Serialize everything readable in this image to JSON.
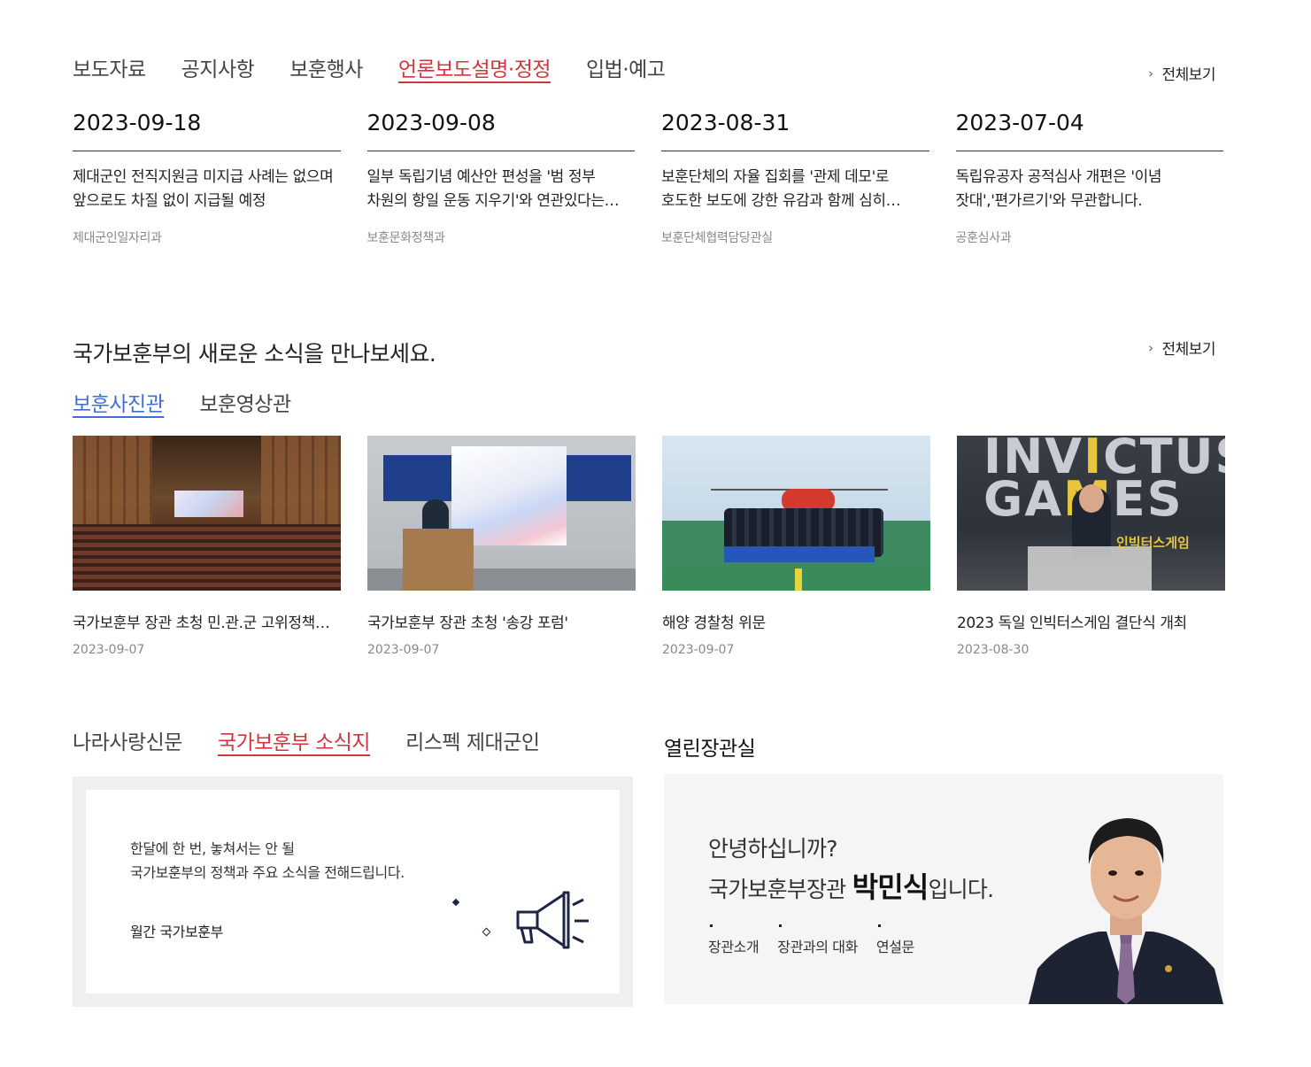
{
  "news": {
    "tabs": [
      "보도자료",
      "공지사항",
      "보훈행사",
      "언론보도설명·정정",
      "입법·예고"
    ],
    "active_tab": 3,
    "view_all": "전체보기",
    "items": [
      {
        "date": "2023-09-18",
        "title": "제대군인 전직지원금 미지급 사례는 없으며 앞으로도 차질 없이 지급될 예정",
        "dept": "제대군인일자리과"
      },
      {
        "date": "2023-09-08",
        "title": "일부 독립기념 예산안 편성을 '범 정부 차원의 항일 운동 지우기'와 연관있다는 보도는 사실과 다릅니다",
        "dept": "보훈문화정책과"
      },
      {
        "date": "2023-08-31",
        "title": "보훈단체의 자율 집회를 '관제 데모'로 호도한 보도에 강한 유감과 함께 심히 우려를 표합니다",
        "dept": "보훈단체협력담당관실"
      },
      {
        "date": "2023-07-04",
        "title": "독립유공자 공적심사 개편은 '이념 잣대','편가르기'와 무관합니다.",
        "dept": "공훈심사과"
      }
    ]
  },
  "gallery": {
    "heading": "국가보훈부의 새로운 소식을 만나보세요.",
    "view_all": "전체보기",
    "tabs": [
      "보훈사진관",
      "보훈영상관"
    ],
    "active_tab": 0,
    "items": [
      {
        "title": "국가보훈부 장관 초청 민.관.군 고위정책과정 특강",
        "date": "2023-09-07"
      },
      {
        "title": "국가보훈부 장관 초청 '송강 포럼'",
        "date": "2023-09-07"
      },
      {
        "title": "해양 경찰청 위문",
        "date": "2023-09-07"
      },
      {
        "title": "2023 독일 인빅터스게임 결단식 개최",
        "date": "2023-08-30"
      }
    ],
    "photo_texts": {
      "invictus_line1a": "INV",
      "invictus_line1b": "I",
      "invictus_line1c": "CTUS",
      "invictus_line2a": "GA",
      "invictus_line2b": "M",
      "invictus_line2c": "ES",
      "invictus_sub": "인빅터스게임"
    }
  },
  "newsletter": {
    "tabs": [
      "나라사랑신문",
      "국가보훈부 소식지",
      "리스펙 제대군인"
    ],
    "active_tab": 1,
    "desc_line1": "한달에 한 번, 놓쳐서는 안 될",
    "desc_line2": "국가보훈부의 정책과 주요 소식을 전해드립니다.",
    "label": "월간 국가보훈부",
    "icon": "megaphone-icon"
  },
  "minister": {
    "title": "열린장관실",
    "greeting": "안녕하십니까?",
    "intro_prefix": "국가보훈부장관 ",
    "name": "박민식",
    "intro_suffix": "입니다.",
    "links": [
      "장관소개",
      "장관과의 대화",
      "연설문"
    ]
  },
  "colors": {
    "active_red": "#d3343d",
    "active_blue": "#3f6fd1",
    "navy": "#1c2541"
  }
}
